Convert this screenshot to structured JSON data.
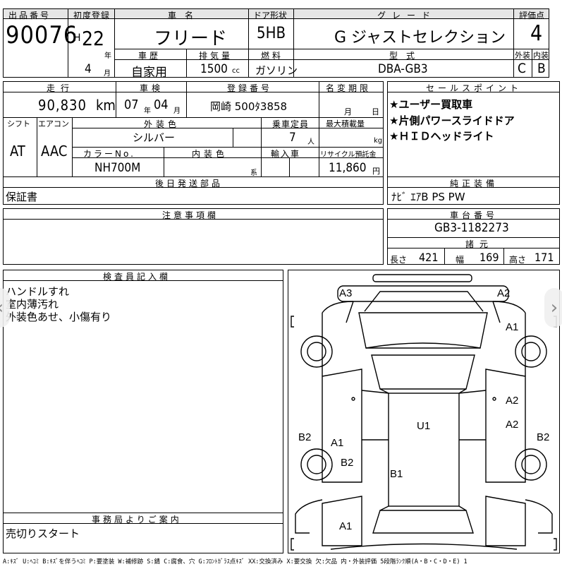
{
  "sheet": {
    "lot": {
      "label": "出品番号",
      "value": "90076"
    },
    "first_reg": {
      "label": "初度登録",
      "era": "H",
      "year": "22",
      "year_unit": "年",
      "month": "4",
      "month_unit": "月"
    },
    "car_name": {
      "label": "車名",
      "value": "フリード"
    },
    "door": {
      "label": "ドア形状",
      "value": "5HB"
    },
    "grade": {
      "label": "グレード",
      "value": "G ジャストセレクション"
    },
    "score": {
      "label": "評価点",
      "value": "4"
    },
    "history": {
      "label": "車歴",
      "value": "自家用"
    },
    "displacement": {
      "label": "排気量",
      "value": "1500",
      "unit": "cc"
    },
    "fuel": {
      "label": "燃料",
      "value": "ガソリン"
    },
    "model_code": {
      "label": "型式",
      "value": "DBA-GB3"
    },
    "exterior_grade": {
      "label": "外装",
      "value": "C"
    },
    "interior_grade": {
      "label": "内装",
      "value": "B"
    },
    "mileage": {
      "label": "走行",
      "value": "90,830",
      "unit": "km"
    },
    "inspection": {
      "label": "車検",
      "year": "07",
      "year_unit": "年",
      "month": "04",
      "month_unit": "月"
    },
    "plate": {
      "label": "登録番号",
      "value": "岡崎 500ﾀ3858"
    },
    "name_change": {
      "label": "名変期限",
      "month_unit": "月",
      "day_unit": "日"
    },
    "shift": {
      "label": "シフト",
      "value": "AT"
    },
    "aircon": {
      "label": "エアコン",
      "value": "AAC"
    },
    "ext_color": {
      "label": "外装色",
      "value": "シルバー"
    },
    "capacity": {
      "label": "乗車定員",
      "value": "7",
      "unit": "人"
    },
    "max_load": {
      "label": "最大積載量",
      "unit": "kg"
    },
    "color_no": {
      "label": "カラーNo.",
      "value": "NH700M"
    },
    "int_color": {
      "label": "内装色",
      "unit": "系"
    },
    "import": {
      "label": "輸入車"
    },
    "recycle": {
      "label": "リサイクル預託金",
      "value": "11,860",
      "unit": "円"
    },
    "selling_points": {
      "label": "セールスポイント",
      "items": [
        "★ユーザー買取車",
        "★片側パワースライドドア",
        "★ＨＩＤヘッドライト"
      ]
    },
    "later_parts": {
      "label": "後日発送部品",
      "value": "保証書"
    },
    "equipment": {
      "label": "純正装備",
      "value": "ﾅﾋﾞ ｴｱB PS PW"
    },
    "notes": {
      "label": "注意事項欄"
    },
    "chassis": {
      "label": "車台番号",
      "value": "GB3-1182273"
    },
    "dims": {
      "label": "諸元",
      "length_label": "長さ",
      "length": "421",
      "width_label": "幅",
      "width": "169",
      "height_label": "高さ",
      "height": "171"
    },
    "inspector": {
      "label": "検査員記入欄",
      "lines": [
        "ハンドルすれ",
        "室内薄汚れ",
        "外装色あせ、小傷有り"
      ]
    },
    "office": {
      "label": "事務局よりご案内",
      "value": "売切りスタート"
    },
    "diagram_marks": [
      "A3",
      "A2",
      "A1",
      "A2",
      "A2",
      "U1",
      "B2",
      "A1",
      "B2",
      "B1",
      "B2",
      "A1"
    ],
    "legend": "A:ｷｽﾞ U:ﾍｺﾐ B:ｷｽﾞを伴うﾍｺﾐ P:要塗装 W:補修跡 S:錆 C:腐食、穴 G:ﾌﾛﾝﾄｶﾞﾗｽ点ｷｽﾞ XX:交換済み X:要交換 欠:欠品 内・外装評価 5段階ﾗﾝｸ順(A・B・C・D・E) 1"
  },
  "nav": {
    "prev": "‹",
    "next": "›"
  }
}
